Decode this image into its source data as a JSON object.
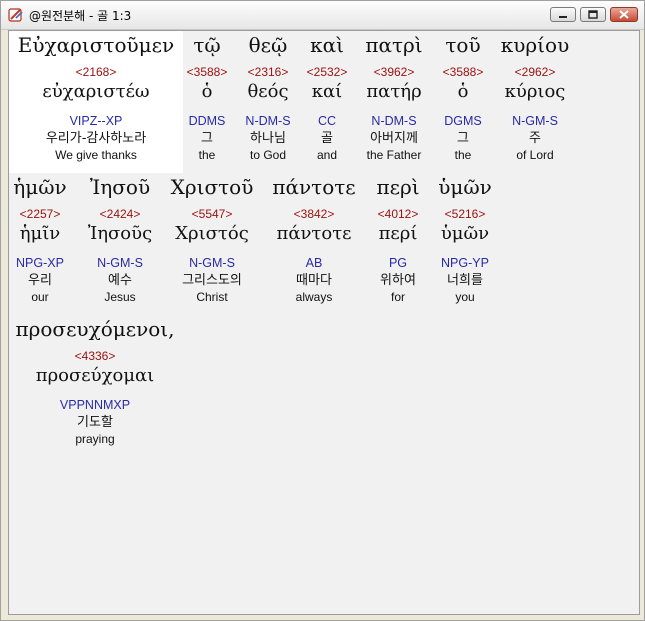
{
  "window": {
    "title": "@원전분해 - 골 1:3"
  },
  "icons": {
    "app": "app-logo-icon",
    "minimize": "minimize-icon",
    "maximize": "maximize-icon",
    "close": "close-icon"
  },
  "colors": {
    "strong_number": "#9b1010",
    "parsing_code": "#2a2aa8",
    "highlight_bg": "#ffffff"
  },
  "rows": [
    {
      "words": [
        {
          "surface": "Εὐχαριστοῦμεν",
          "strong": "<2168>",
          "lemma": "εὐχαριστέω",
          "parse": "VIPZ--XP",
          "korean": "우리가-감사하노라",
          "english": "We give thanks",
          "selected": true
        },
        {
          "surface": "τῷ",
          "strong": "<3588>",
          "lemma": "ὁ",
          "parse": "DDMS",
          "korean": "그",
          "english": "the"
        },
        {
          "surface": "θεῷ",
          "strong": "<2316>",
          "lemma": "θεός",
          "parse": "N-DM-S",
          "korean": "하나님",
          "english": "to God"
        },
        {
          "surface": "καὶ",
          "strong": "<2532>",
          "lemma": "καί",
          "parse": "CC",
          "korean": "골",
          "english": "and"
        },
        {
          "surface": "πατρὶ",
          "strong": "<3962>",
          "lemma": "πατήρ",
          "parse": "N-DM-S",
          "korean": "아버지께",
          "english": "the Father"
        },
        {
          "surface": "τοῦ",
          "strong": "<3588>",
          "lemma": "ὁ",
          "parse": "DGMS",
          "korean": "그",
          "english": "the"
        },
        {
          "surface": "κυρίου",
          "strong": "<2962>",
          "lemma": "κύριος",
          "parse": "N-GM-S",
          "korean": "주",
          "english": "of Lord"
        }
      ]
    },
    {
      "words": [
        {
          "surface": "ἡμῶν",
          "strong": "<2257>",
          "lemma": "ἡμῖν",
          "parse": "NPG-XP",
          "korean": "우리",
          "english": "our"
        },
        {
          "surface": "Ἰησοῦ",
          "strong": "<2424>",
          "lemma": "Ἰησοῦς",
          "parse": "N-GM-S",
          "korean": "예수",
          "english": "Jesus"
        },
        {
          "surface": "Χριστοῦ",
          "strong": "<5547>",
          "lemma": "Χριστός",
          "parse": "N-GM-S",
          "korean": "그리스도의",
          "english": "Christ"
        },
        {
          "surface": "πάντοτε",
          "strong": "<3842>",
          "lemma": "πάντοτε",
          "parse": "AB",
          "korean": "때마다",
          "english": "always"
        },
        {
          "surface": "περὶ",
          "strong": "<4012>",
          "lemma": "περί",
          "parse": "PG",
          "korean": "위하여",
          "english": "for"
        },
        {
          "surface": "ὑμῶν",
          "strong": "<5216>",
          "lemma": "ὑμῶν",
          "parse": "NPG-YP",
          "korean": "너희를",
          "english": "you"
        }
      ]
    },
    {
      "words": [
        {
          "surface": "προσευχόμενοι,",
          "strong": "<4336>",
          "lemma": "προσεύχομαι",
          "parse": "VPPNNMXP",
          "korean": "기도할",
          "english": "praying"
        }
      ]
    }
  ]
}
